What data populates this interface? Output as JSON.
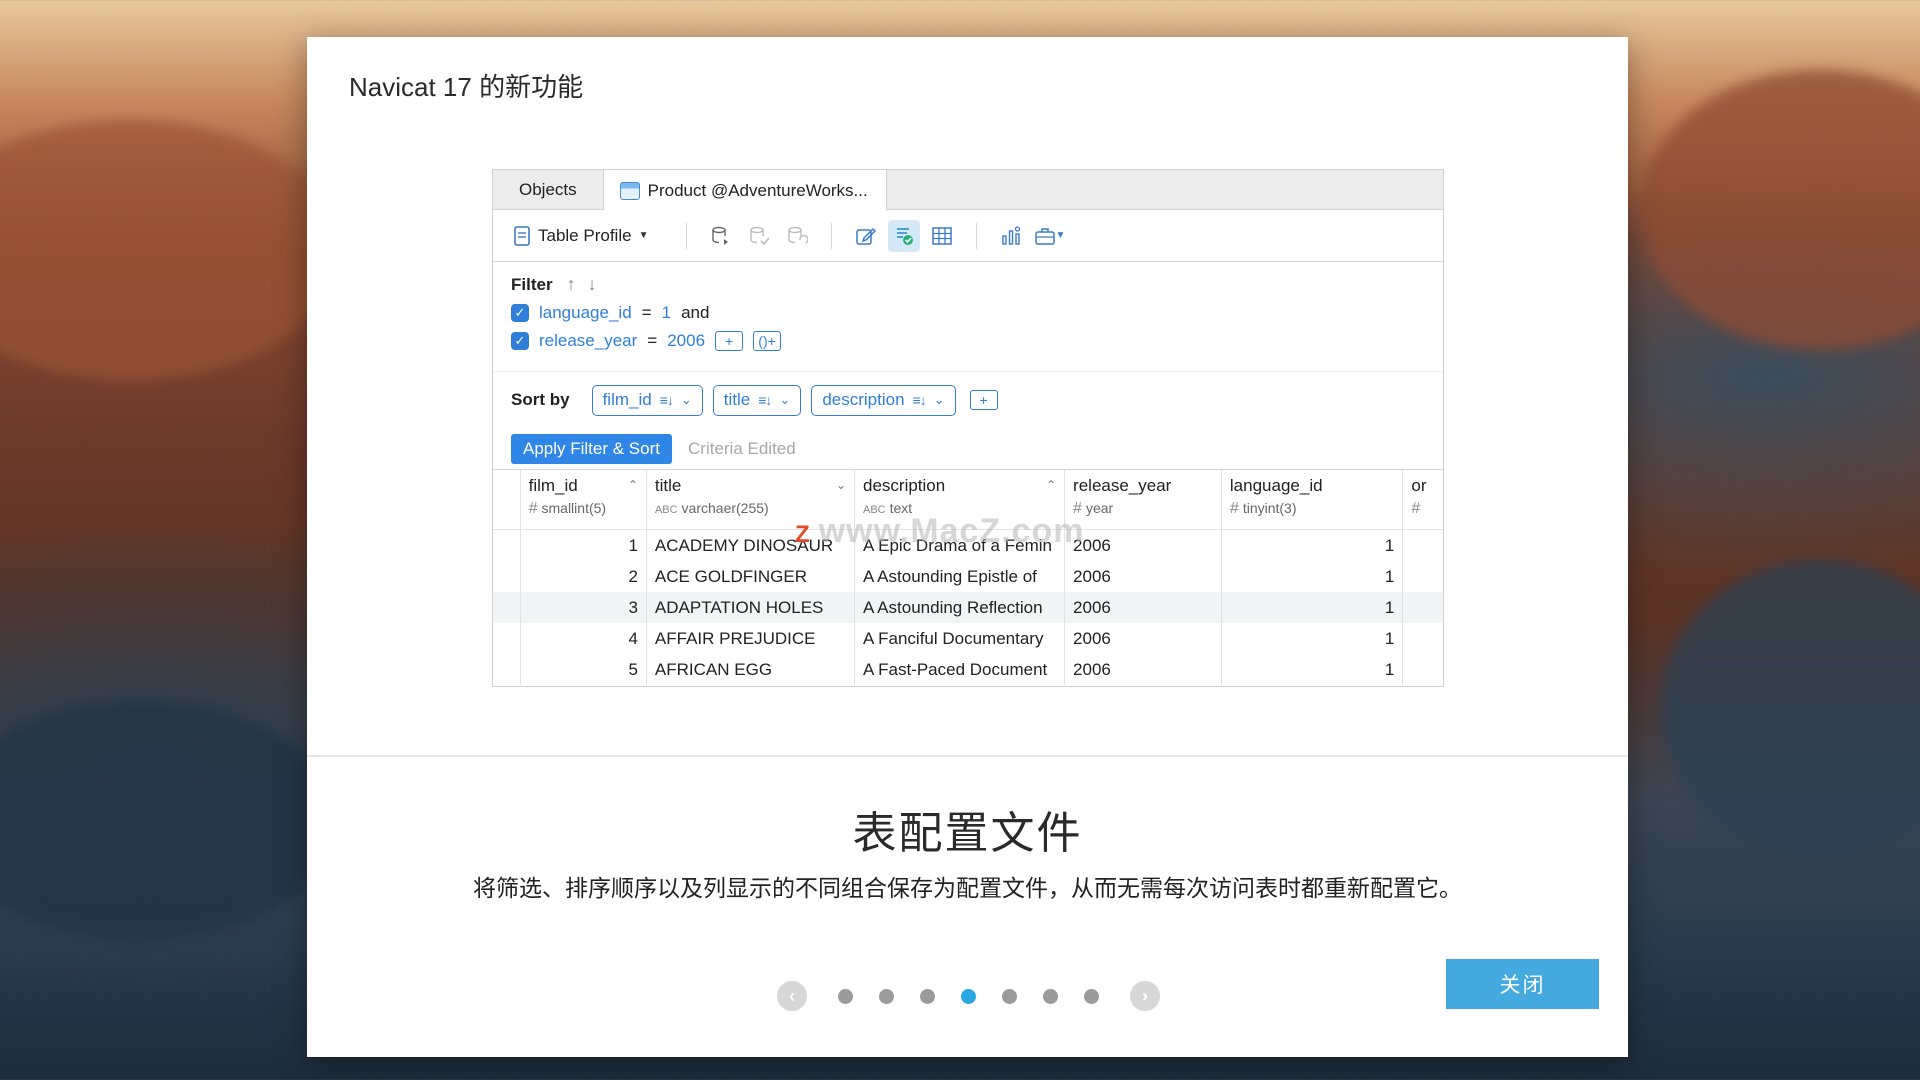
{
  "dialog": {
    "title": "Navicat 17 的新功能",
    "heading": "表配置文件",
    "description": "将筛选、排序顺序以及列显示的不同组合保存为配置文件，从而无需每次访问表时都重新配置它。",
    "close_label": "关闭"
  },
  "window": {
    "tabs": [
      {
        "label": "Objects"
      },
      {
        "label": "Product @AdventureWorks..."
      }
    ],
    "toolbar": {
      "profile_label": "Table Profile"
    },
    "filter": {
      "label": "Filter",
      "conditions": [
        {
          "field": "language_id",
          "op": "=",
          "value": "1",
          "conj": "and"
        },
        {
          "field": "release_year",
          "op": "=",
          "value": "2006",
          "conj": ""
        }
      ]
    },
    "sort": {
      "label": "Sort by",
      "fields": [
        "film_id",
        "title",
        "description"
      ]
    },
    "apply_label": "Apply Filter & Sort",
    "criteria_label": "Criteria Edited",
    "grid": {
      "columns": [
        {
          "name": "film_id",
          "type": "smallint(5)"
        },
        {
          "name": "title",
          "type": "varchaer(255)"
        },
        {
          "name": "description",
          "type": "text"
        },
        {
          "name": "release_year",
          "type": "year"
        },
        {
          "name": "language_id",
          "type": "tinyint(3)"
        },
        {
          "name": "or",
          "type": ""
        }
      ],
      "rows": [
        [
          "1",
          "ACADEMY DINOSAUR",
          "A Epic Drama of a Femin",
          "2006",
          "1"
        ],
        [
          "2",
          "ACE GOLDFINGER",
          "A Astounding Epistle of",
          "2006",
          "1"
        ],
        [
          "3",
          "ADAPTATION HOLES",
          "A Astounding Reflection",
          "2006",
          "1"
        ],
        [
          "4",
          "AFFAIR PREJUDICE",
          "A Fanciful Documentary",
          "2006",
          "1"
        ],
        [
          "5",
          "AFRICAN EGG",
          "A Fast-Paced Document",
          "2006",
          "1"
        ]
      ]
    }
  },
  "watermark": "www.MacZ.com",
  "colors": {
    "accent": "#2f7fd9",
    "close_button": "#43a9de",
    "active_dot": "#2aa6e0"
  }
}
